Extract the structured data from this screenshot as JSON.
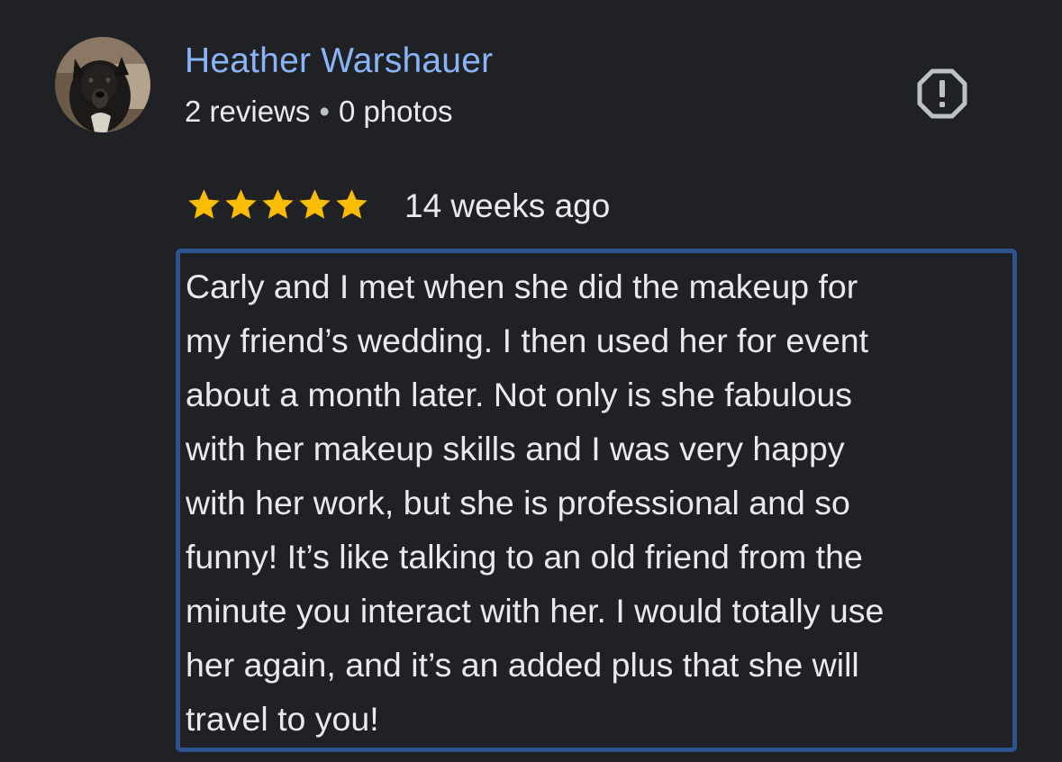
{
  "reviewer": {
    "name": "Heather Warshauer",
    "reviews_count": "2 reviews",
    "separator": "•",
    "photos_count": "0 photos"
  },
  "icons": {
    "avatar": "dog-profile-photo",
    "report": "report-flag-octagon-exclamation-icon",
    "star": "star-icon"
  },
  "rating": {
    "stars": 5,
    "max_stars": 5,
    "date": "14 weeks ago"
  },
  "review": {
    "text": "Carly and I met when she did the makeup for\nmy friend’s wedding. I then used her for event\nabout a month later. Not only is she fabulous\nwith her makeup skills and I was very happy\nwith her work, but she is professional and so\nfunny! It’s like talking to an old friend from the\nminute you interact with her. I would totally use\nher again, and it’s an added plus that she will\ntravel to you!"
  },
  "colors": {
    "background": "#202124",
    "name": "#8ab4f8",
    "text": "#e8eaed",
    "star": "#fbbc04",
    "highlight_border": "#2e5390",
    "icon": "#bdc1c6"
  }
}
